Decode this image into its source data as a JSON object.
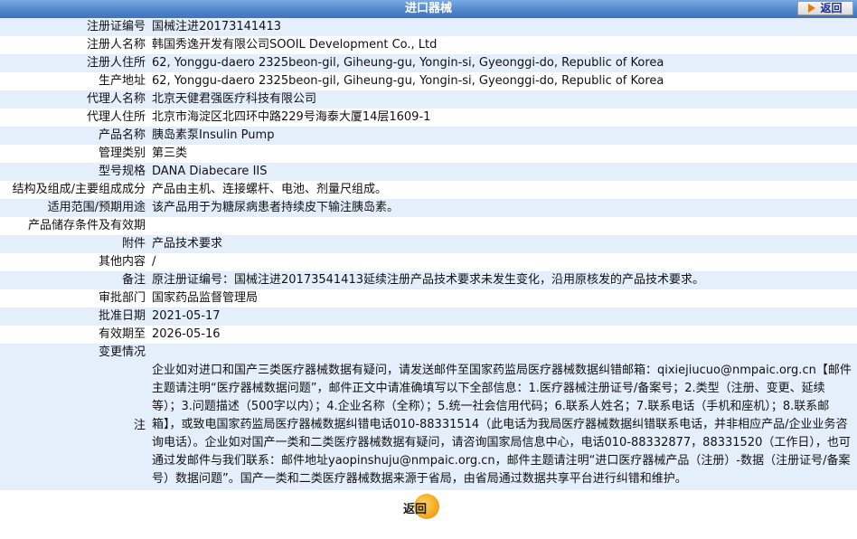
{
  "header": {
    "title": "进口器械",
    "back_label": "返回"
  },
  "rows": [
    {
      "label": "注册证编号",
      "value": "国械注进20173141413"
    },
    {
      "label": "注册人名称",
      "value": "韩国秀逸开发有限公司SOOIL Development Co., Ltd"
    },
    {
      "label": "注册人住所",
      "value": "62, Yonggu-daero 2325beon-gil, Giheung-gu, Yongin-si, Gyeonggi-do, Republic of Korea"
    },
    {
      "label": "生产地址",
      "value": "62, Yonggu-daero 2325beon-gil, Giheung-gu, Yongin-si, Gyeonggi-do, Republic of Korea"
    },
    {
      "label": "代理人名称",
      "value": "北京天健君强医疗科技有限公司"
    },
    {
      "label": "代理人住所",
      "value": "北京市海淀区北四环中路229号海泰大厦14层1609-1"
    },
    {
      "label": "产品名称",
      "value": "胰岛素泵Insulin Pump"
    },
    {
      "label": "管理类别",
      "value": "第三类"
    },
    {
      "label": "型号规格",
      "value": "DANA Diabecare IIS"
    },
    {
      "label": "结构及组成/主要组成成分",
      "value": "产品由主机、连接螺杆、电池、剂量尺组成。"
    },
    {
      "label": "适用范围/预期用途",
      "value": "该产品用于为糖尿病患者持续皮下输注胰岛素。"
    },
    {
      "label": "产品储存条件及有效期",
      "value": ""
    },
    {
      "label": "附件",
      "value": "产品技术要求"
    },
    {
      "label": "其他内容",
      "value": "/"
    },
    {
      "label": "备注",
      "value": "原注册证编号：国械注进20173541413延续注册产品技术要求未发生变化，沿用原核发的产品技术要求。"
    },
    {
      "label": "审批部门",
      "value": "国家药品监督管理局"
    },
    {
      "label": "批准日期",
      "value": "2021-05-17"
    },
    {
      "label": "有效期至",
      "value": "2026-05-16"
    },
    {
      "label": "变更情况",
      "value": ""
    }
  ],
  "note": {
    "label": "注",
    "text": "企业如对进口和国产三类医疗器械数据有疑问，请发送邮件至国家药监局医疗器械数据纠错邮箱：qixiejiucuo@nmpaic.org.cn【邮件主题请注明“医疗器械数据问题”，邮件正文中请准确填写以下全部信息：1.医疗器械注册证号/备案号；2.类型（注册、变更、延续等）；3.问题描述（500字以内）；4.企业名称（全称）；5.统一社会信用代码；6.联系人姓名；7.联系电话（手机和座机）；8.联系邮箱】，或致电国家药监局医疗器械数据纠错电话010-88331514（此电话为我局医疗器械数据纠错联系电话，并非相应产品/企业业务咨询电话）。企业如对国产一类和二类医疗器械数据有疑问，请咨询国家局信息中心，电话010-88332877，88331520（工作日），也可通过发邮件与我们联系：邮件地址yaopinshuju@nmpaic.org.cn，邮件主题请注明“进口医疗器械产品（注册）-数据（注册证号/备案号）数据问题”。国产一类和二类医疗器械数据来源于省局，由省局通过数据共享平台进行纠错和维护。"
  },
  "footer": {
    "back_label": "返回"
  }
}
